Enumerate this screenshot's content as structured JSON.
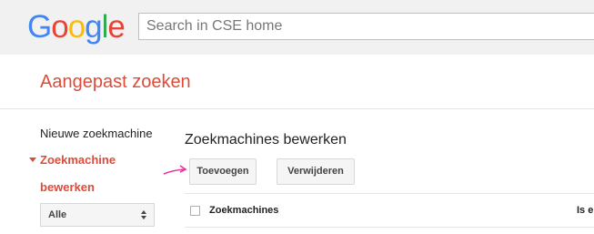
{
  "header": {
    "logo": [
      "G",
      "o",
      "o",
      "g",
      "l",
      "e"
    ],
    "logo_colors": [
      "#4285F4",
      "#EA4335",
      "#FBBC05",
      "#4285F4",
      "#34A853",
      "#EA4335"
    ],
    "search_placeholder": "Search in CSE home"
  },
  "app": {
    "title": "Aangepast zoeken",
    "accent_color": "#dd4b39"
  },
  "sidebar": {
    "new_engine": "Nieuwe zoekmachine",
    "edit_engine_line1": "Zoekmachine",
    "edit_engine_line2": "bewerken",
    "filter": {
      "selected": "Alle"
    }
  },
  "main": {
    "section_title": "Zoekmachines bewerken",
    "add_button": "Toevoegen",
    "delete_button": "Verwijderen",
    "table": {
      "columns": [
        "Zoekmachines",
        "Is e"
      ]
    }
  },
  "annotation": {
    "arrow_color": "#e0379a"
  }
}
